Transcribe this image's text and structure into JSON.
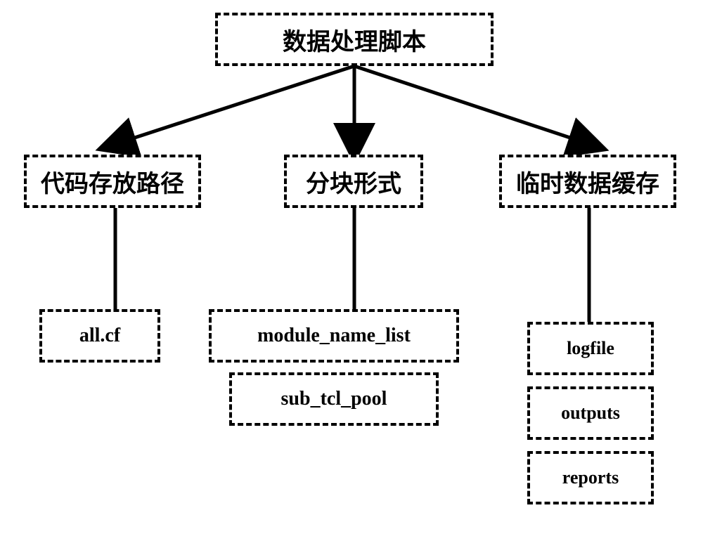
{
  "root": {
    "label": "数据处理脚本"
  },
  "level1": {
    "code_path": {
      "label": "代码存放路径"
    },
    "block_form": {
      "label": "分块形式"
    },
    "temp_cache": {
      "label": "临时数据缓存"
    }
  },
  "code_path_children": {
    "all_cf": {
      "label": "all.cf"
    }
  },
  "block_form_children": {
    "module_name_list": {
      "label": "module_name_list"
    },
    "sub_tcl_pool": {
      "label": "sub_tcl_pool"
    }
  },
  "temp_cache_children": {
    "logfile": {
      "label": "logfile"
    },
    "outputs": {
      "label": "outputs"
    },
    "reports": {
      "label": "reports"
    }
  }
}
